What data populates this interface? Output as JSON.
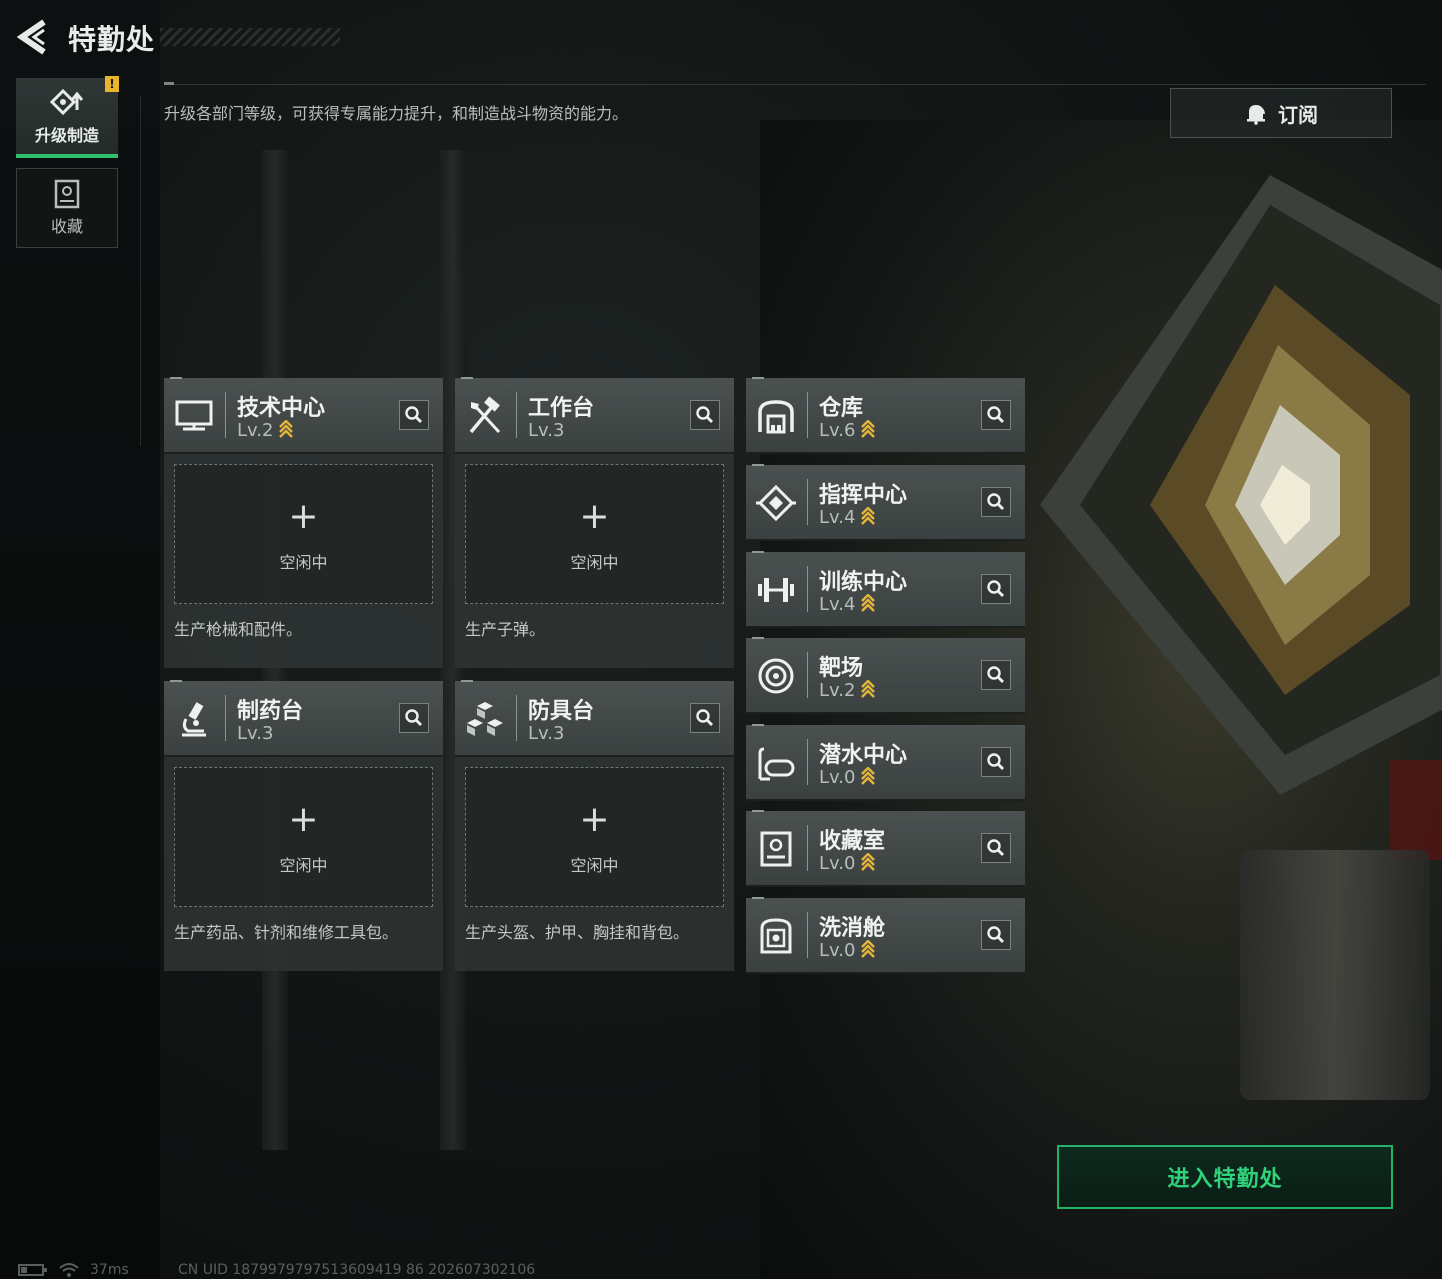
{
  "header": {
    "title": "特勤处"
  },
  "side_tabs": [
    {
      "label": "升级制造",
      "active": true,
      "icon": "upgrade-icon"
    },
    {
      "label": "收藏",
      "active": false,
      "icon": "collection-icon"
    }
  ],
  "alert_badge": "!",
  "description": "升级各部门等级，可获得专属能力提升，和制造战斗物资的能力。",
  "subscribe": {
    "label": "订阅",
    "icon": "bell-icon"
  },
  "production_cards": [
    {
      "name": "技术中心",
      "level": "Lv.2",
      "upgradeable": true,
      "icon": "monitor-icon",
      "slot_plus": "+",
      "slot_status": "空闲中",
      "desc": "生产枪械和配件。"
    },
    {
      "name": "工作台",
      "level": "Lv.3",
      "upgradeable": false,
      "icon": "tools-icon",
      "slot_plus": "+",
      "slot_status": "空闲中",
      "desc": "生产子弹。"
    },
    {
      "name": "制药台",
      "level": "Lv.3",
      "upgradeable": false,
      "icon": "microscope-icon",
      "slot_plus": "+",
      "slot_status": "空闲中",
      "desc": "生产药品、针剂和维修工具包。"
    },
    {
      "name": "防具台",
      "level": "Lv.3",
      "upgradeable": false,
      "icon": "armor-blocks-icon",
      "slot_plus": "+",
      "slot_status": "空闲中",
      "desc": "生产头盔、护甲、胸挂和背包。"
    }
  ],
  "facilities": [
    {
      "name": "仓库",
      "level": "Lv.6",
      "upgradeable": true,
      "icon": "warehouse-icon"
    },
    {
      "name": "指挥中心",
      "level": "Lv.4",
      "upgradeable": true,
      "icon": "command-icon"
    },
    {
      "name": "训练中心",
      "level": "Lv.4",
      "upgradeable": true,
      "icon": "dumbbell-icon"
    },
    {
      "name": "靶场",
      "level": "Lv.2",
      "upgradeable": true,
      "icon": "target-icon"
    },
    {
      "name": "潜水中心",
      "level": "Lv.0",
      "upgradeable": true,
      "icon": "diving-mask-icon"
    },
    {
      "name": "收藏室",
      "level": "Lv.0",
      "upgradeable": true,
      "icon": "display-case-icon"
    },
    {
      "name": "洗消舱",
      "level": "Lv.0",
      "upgradeable": true,
      "icon": "decontamination-icon"
    }
  ],
  "enter_button": {
    "label": "进入特勤处"
  },
  "status": {
    "ping": "37ms",
    "uid": "CN UID 1879979797513609419 86 202607302106"
  },
  "colors": {
    "accent_green": "#2ec06e",
    "upgrade_gold": "#e3b53a",
    "alert_yellow": "#e8b52c"
  }
}
